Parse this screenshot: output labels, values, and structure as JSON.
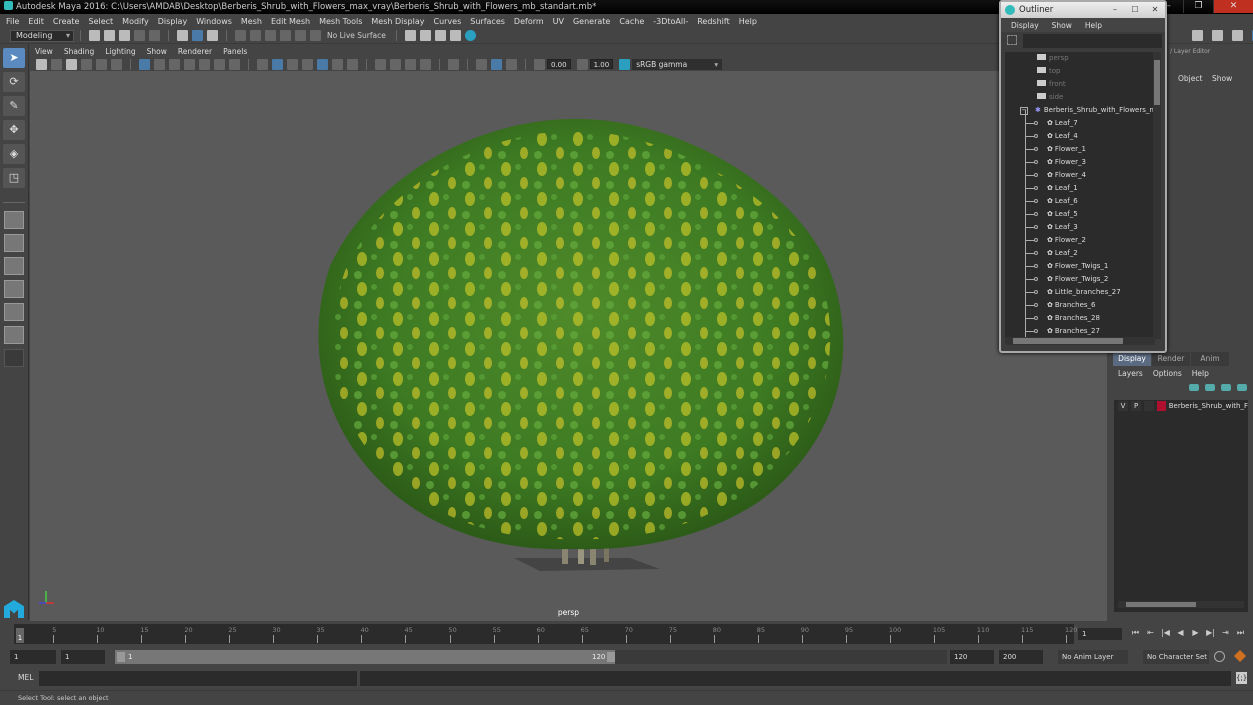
{
  "app": {
    "title": "Autodesk Maya 2016: C:\\Users\\AMDAB\\Desktop\\Berberis_Shrub_with_Flowers_max_vray\\Berberis_Shrub_with_Flowers_mb_standart.mb*",
    "window_controls": {
      "minimize": "–",
      "restore": "❐",
      "close": "✕"
    }
  },
  "menubar": [
    "File",
    "Edit",
    "Create",
    "Select",
    "Modify",
    "Display",
    "Windows",
    "Mesh",
    "Edit Mesh",
    "Mesh Tools",
    "Mesh Display",
    "Curves",
    "Surfaces",
    "Deform",
    "UV",
    "Generate",
    "Cache",
    "-3DtoAll-",
    "Redshift",
    "Help"
  ],
  "shelf": {
    "mode": "Modeling",
    "live_surface": "No Live Surface"
  },
  "viewport": {
    "menu": [
      "View",
      "Shading",
      "Lighting",
      "Show",
      "Renderer",
      "Panels"
    ],
    "exposure": "0.00",
    "gamma_value": "1.00",
    "color_space": "sRGB gamma",
    "camera_label": "persp"
  },
  "outliner": {
    "title": "Outliner",
    "menu": [
      "Display",
      "Show",
      "Help"
    ],
    "cameras": [
      "persp",
      "top",
      "front",
      "side"
    ],
    "root": "Berberis_Shrub_with_Flowers_n",
    "children": [
      "Leaf_7",
      "Leaf_4",
      "Flower_1",
      "Flower_3",
      "Flower_4",
      "Leaf_1",
      "Leaf_6",
      "Leaf_5",
      "Leaf_3",
      "Flower_2",
      "Leaf_2",
      "Flower_Twigs_1",
      "Flower_Twigs_2",
      "Little_branches_27",
      "Branches_6",
      "Branches_28",
      "Branches_27"
    ]
  },
  "channel_box": {
    "header": "/ Layer Editor",
    "columns": [
      "Object",
      "Show"
    ]
  },
  "layer_editor": {
    "tabs": [
      "Display",
      "Render",
      "Anim"
    ],
    "active_tab": "Display",
    "menu": [
      "Layers",
      "Options",
      "Help"
    ],
    "layers": [
      {
        "v": "V",
        "p": "P",
        "color": "#b01030",
        "name": "Berberis_Shrub_with_F"
      }
    ]
  },
  "timeline": {
    "ticks": [
      5,
      10,
      15,
      20,
      25,
      30,
      35,
      40,
      45,
      50,
      55,
      60,
      65,
      70,
      75,
      80,
      85,
      90,
      95,
      100,
      105,
      110,
      115,
      120
    ],
    "current_frame": "1",
    "frame_field": "1",
    "playback": [
      "⏮",
      "⇤",
      "|◀",
      "◀",
      "▶",
      "▶|",
      "⇥",
      "⏭"
    ]
  },
  "range": {
    "start": "1",
    "playback_start": "1",
    "slider_start": "1",
    "slider_end": "120",
    "playback_end": "120",
    "end": "200",
    "anim_layer": "No Anim Layer",
    "character_set": "No Character Set"
  },
  "command_line": {
    "label": "MEL"
  },
  "status": {
    "message": "Select Tool: select an object"
  }
}
